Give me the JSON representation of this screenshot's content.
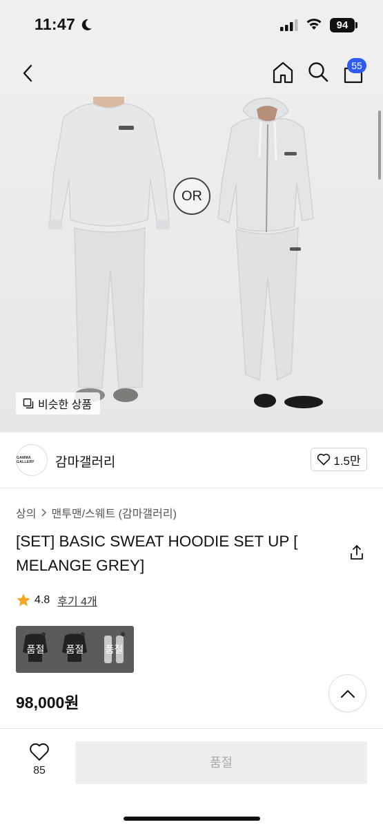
{
  "status_bar": {
    "time": "11:47",
    "battery": "94",
    "icons": [
      "moon-icon",
      "signal-icon",
      "wifi-icon",
      "battery-icon"
    ]
  },
  "nav": {
    "cart_count": "55",
    "icons": [
      "back-chevron-icon",
      "home-icon",
      "search-icon",
      "cart-icon"
    ]
  },
  "hero": {
    "or_label": "OR",
    "similar_products_label": "비슷한 상품"
  },
  "brand": {
    "logo_text": "GAMMA GALLERY",
    "name": "감마갤러리",
    "likes": "1.5만"
  },
  "product": {
    "breadcrumb": [
      "상의",
      "맨투맨/스웨트 (감마갤러리)"
    ],
    "title": "[SET] BASIC SWEAT HOODIE SET UP [ MELANGE GREY]",
    "rating": "4.8",
    "review_link": "후기 4개",
    "options": [
      {
        "label": "품절"
      },
      {
        "label": "품절"
      },
      {
        "label": "품절"
      }
    ],
    "price": "98,000원"
  },
  "bottom_bar": {
    "wish_count": "85",
    "soldout_label": "품절"
  },
  "colors": {
    "accent_badge": "#2f5bf5",
    "star": "#f5a623",
    "hero_bg": "#ececec",
    "soldout_bg": "#eeeeee",
    "soldout_text": "#aaaaaa"
  }
}
